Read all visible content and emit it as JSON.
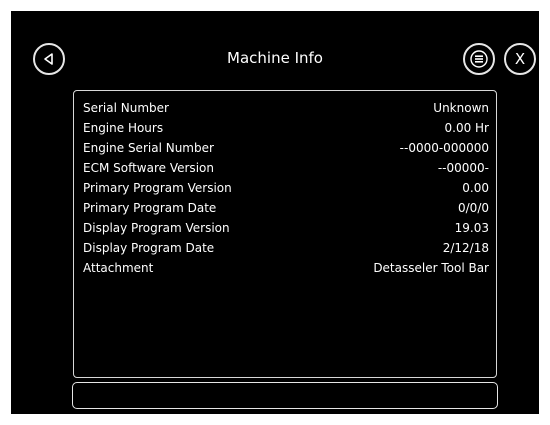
{
  "header": {
    "title": "Machine Info",
    "back_icon": "back-triangle-icon",
    "menu_icon": "menu-lines-icon",
    "close_label": "X"
  },
  "rows": [
    {
      "label": "Serial Number",
      "value": "Unknown"
    },
    {
      "label": "Engine Hours",
      "value": "0.00 Hr"
    },
    {
      "label": "Engine Serial Number",
      "value": "--0000-000000"
    },
    {
      "label": "ECM Software Version",
      "value": "--00000-"
    },
    {
      "label": "Primary Program Version",
      "value": "0.00"
    },
    {
      "label": "Primary Program Date",
      "value": "0/0/0"
    },
    {
      "label": "Display Program Version",
      "value": "19.03"
    },
    {
      "label": "Display Program Date",
      "value": "2/12/18"
    },
    {
      "label": "Attachment",
      "value": "Detasseler Tool Bar"
    }
  ],
  "colors": {
    "background": "#000000",
    "text": "#ffffff",
    "border": "#d8d8d8"
  }
}
